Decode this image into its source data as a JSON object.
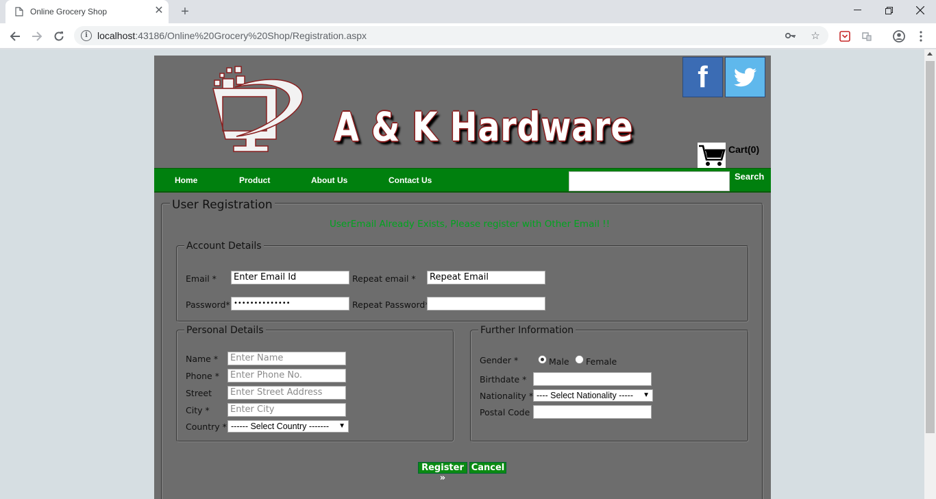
{
  "browser": {
    "tab_title": "Online Grocery Shop",
    "url_host": "localhost",
    "url_rest": ":43186/Online%20Grocery%20Shop/Registration.aspx"
  },
  "site": {
    "brand": "A & K Hardware",
    "cart_label": "Cart(0)",
    "social": {
      "facebook": "f"
    },
    "nav": {
      "home": "Home",
      "product": "Product",
      "about": "About Us",
      "contact": "Contact Us",
      "search_label": "Search",
      "search_value": ""
    }
  },
  "registration": {
    "legend": "User Registration",
    "error_message": "UserEmail Already Exists, Please register with Other Email !!",
    "account": {
      "legend": "Account Details",
      "email_label": "Email *",
      "email_value": "Enter Email Id",
      "repeat_email_label": "Repeat email *",
      "repeat_email_value": "Repeat Email",
      "password_label": "Password*",
      "password_value": "••••••••••••••",
      "repeat_password_label": "Repeat Password*",
      "repeat_password_value": ""
    },
    "personal": {
      "legend": "Personal Details",
      "name_label": "Name *",
      "name_placeholder": "Enter Name",
      "phone_label": "Phone *",
      "phone_placeholder": "Enter Phone No.",
      "street_label": "Street",
      "street_placeholder": "Enter Street Address",
      "city_label": "City *",
      "city_placeholder": "Enter City",
      "country_label": "Country *",
      "country_selected": "------ Select Country -------"
    },
    "further": {
      "legend": "Further Information",
      "gender_label": "Gender *",
      "gender_options": [
        "Male",
        "Female"
      ],
      "gender_selected": "Male",
      "birthdate_label": "Birthdate *",
      "birthdate_value": "",
      "nationality_label": "Nationality *",
      "nationality_selected": "---- Select Nationality -----",
      "postal_label": "Postal Code",
      "postal_value": ""
    },
    "register_button": "Register »",
    "cancel_button": "Cancel"
  },
  "colors": {
    "nav_green": "#00800e",
    "page_gray": "#6d6d6d",
    "error_green": "#00a51f"
  }
}
